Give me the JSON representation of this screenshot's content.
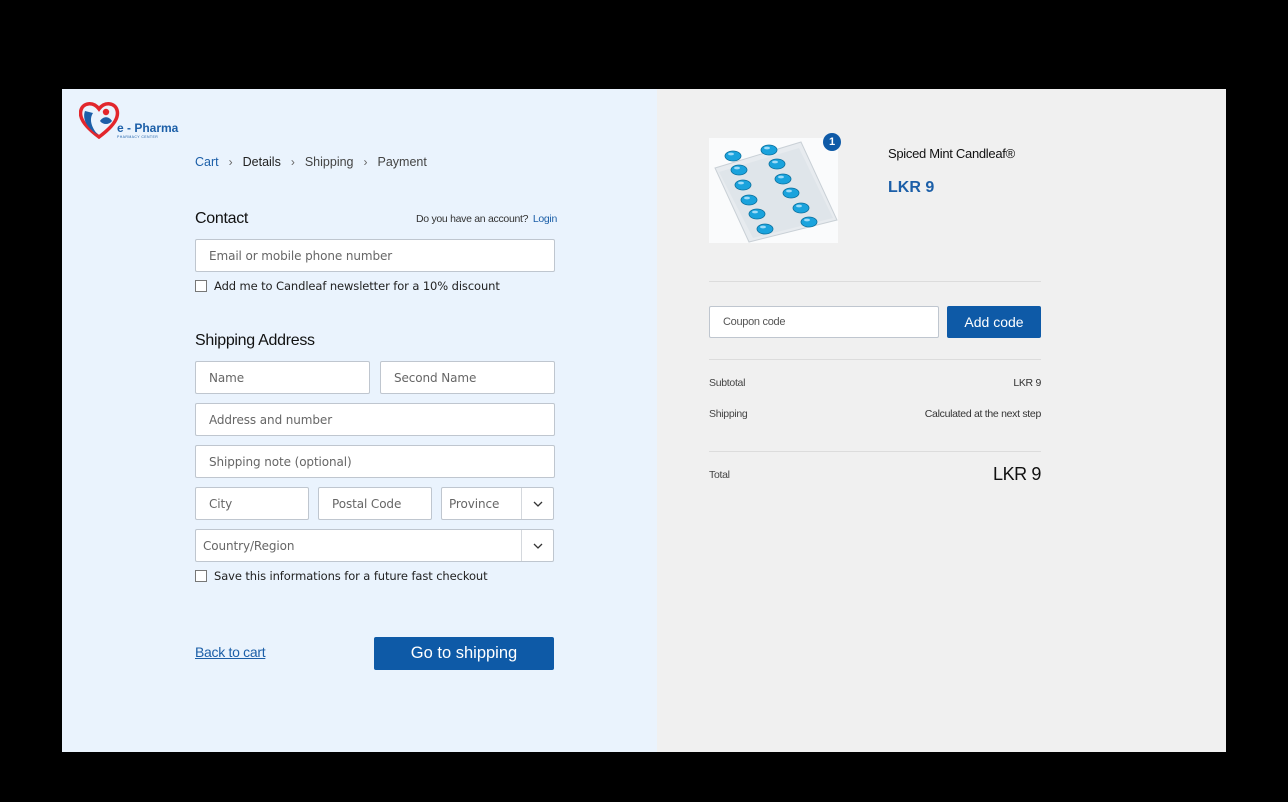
{
  "brand": {
    "name": "e - Pharma",
    "tagline": "PHARMACY CENTER"
  },
  "breadcrumb": [
    {
      "label": "Cart"
    },
    {
      "label": "Details"
    },
    {
      "label": "Shipping"
    },
    {
      "label": "Payment"
    }
  ],
  "contact": {
    "title": "Contact",
    "account_question": "Do you have an account?",
    "login_label": "Login",
    "email_placeholder": "Email or mobile phone number",
    "newsletter_label": "Add me to Candleaf newsletter for a 10% discount"
  },
  "shipping": {
    "title": "Shipping Address",
    "name_placeholder": "Name",
    "second_name_placeholder": "Second Name",
    "address_placeholder": "Address and number",
    "note_placeholder": "Shipping note (optional)",
    "city_placeholder": "City",
    "postal_placeholder": "Postal Code",
    "province_label": "Province",
    "country_label": "Country/Region",
    "save_label": "Save this informations for a future fast checkout"
  },
  "actions": {
    "back_label": "Back to cart",
    "go_label": "Go to shipping"
  },
  "order": {
    "product_name": "Spiced Mint Candleaf®",
    "product_price": "LKR 9",
    "quantity": "1",
    "coupon_placeholder": "Coupon code",
    "add_code_label": "Add code",
    "subtotal_label": "Subtotal",
    "subtotal_value": "LKR 9",
    "shipping_label": "Shipping",
    "shipping_value": "Calculated at the next step",
    "total_label": "Total",
    "total_value": "LKR 9"
  },
  "colors": {
    "accent": "#0e5aa7",
    "left_bg": "#eaf3fd",
    "right_bg": "#f0f0f0",
    "logo_red": "#e2262c"
  },
  "icons": [
    "pharma-heart-logo-icon",
    "chevron-right-icon",
    "chevron-down-icon",
    "pill-blister-image"
  ]
}
